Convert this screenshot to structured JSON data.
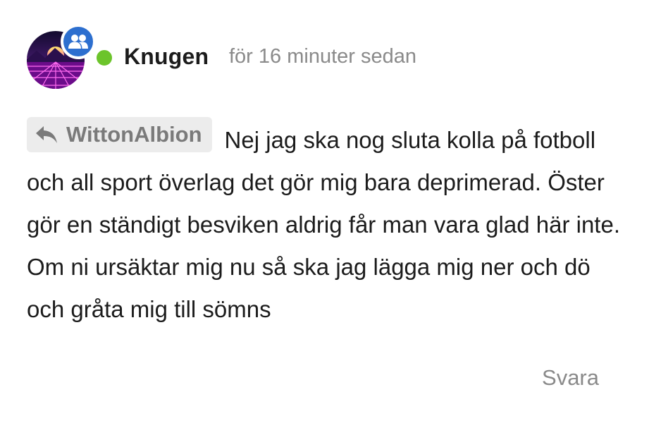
{
  "comment": {
    "author": {
      "name": "Knugen",
      "avatar_icon": "synthwave-grid-avatar",
      "badge_icon": "group-icon",
      "status": "online",
      "status_color": "#6cc42b",
      "badge_color": "#2d6fcf"
    },
    "timestamp": "för 16 minuter sedan",
    "reply_to": {
      "icon": "reply-arrow-icon",
      "name": "WittonAlbion"
    },
    "text": "Nej jag ska nog sluta kolla på fotboll och all sport överlag det gör mig bara deprimerad. Öster gör en ständigt besviken aldrig får man vara glad här inte. Om ni ursäktar mig nu så ska jag lägga mig ner och dö och gråta mig till sömns",
    "actions": {
      "reply_label": "Svara"
    }
  }
}
